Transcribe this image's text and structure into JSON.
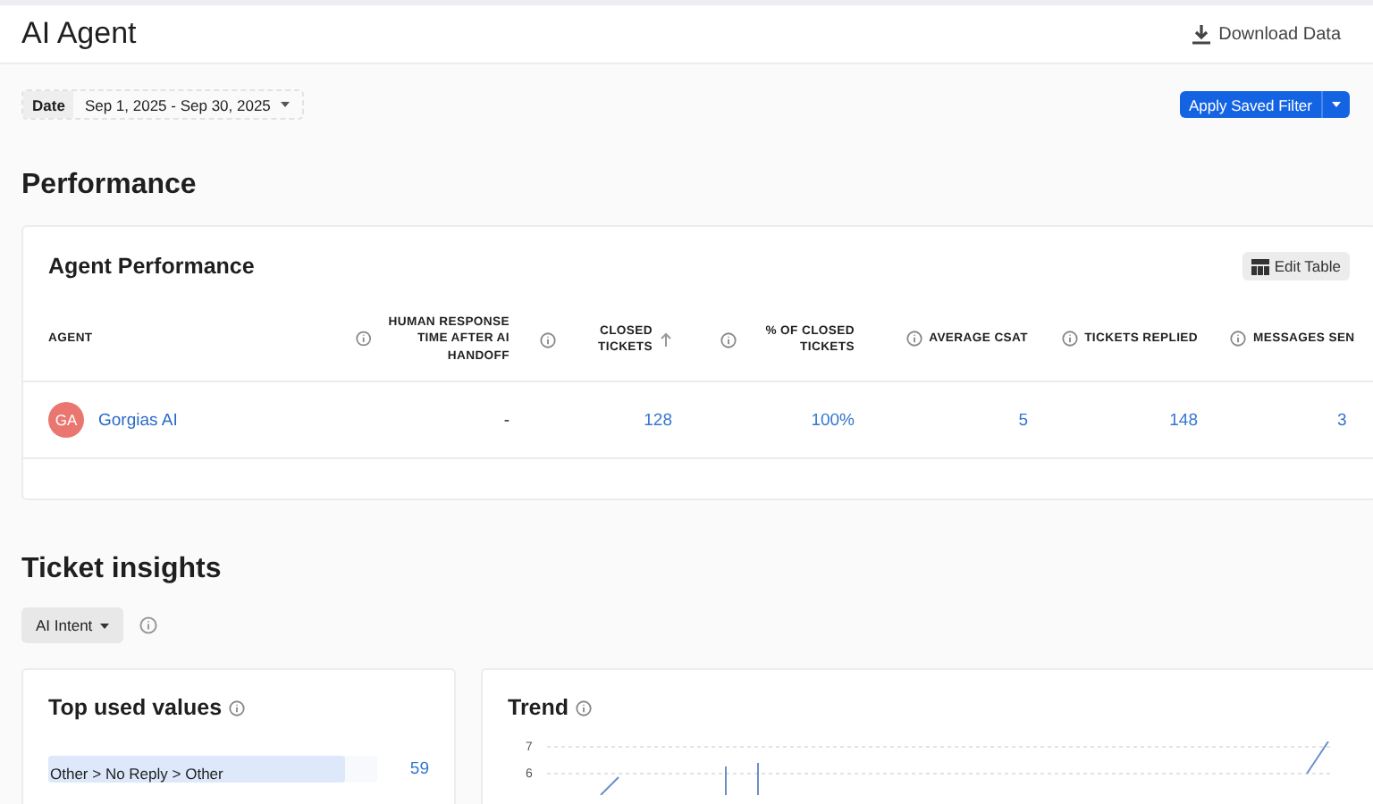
{
  "header": {
    "title": "AI Agent",
    "download_label": "Download Data"
  },
  "filters": {
    "date_label": "Date",
    "date_value": "Sep 1, 2025 - Sep 30, 2025",
    "saved_filter_label": "Apply Saved Filter"
  },
  "performance": {
    "title": "Performance",
    "card_title": "Agent Performance",
    "edit_label": "Edit Table",
    "columns": [
      {
        "label": "AGENT",
        "info": false,
        "sorted": false
      },
      {
        "label": "HUMAN RESPONSE TIME AFTER AI HANDOFF",
        "info": true,
        "sorted": false
      },
      {
        "label": "CLOSED TICKETS",
        "info": true,
        "sorted": true
      },
      {
        "label": "% OF CLOSED TICKETS",
        "info": true,
        "sorted": false
      },
      {
        "label": "AVERAGE CSAT",
        "info": true,
        "sorted": false
      },
      {
        "label": "TICKETS REPLIED",
        "info": true,
        "sorted": false
      },
      {
        "label": "MESSAGES SEN",
        "info": true,
        "sorted": false
      }
    ],
    "rows": [
      {
        "initials": "GA",
        "color": "#e9776f",
        "cells": [
          "Gorgias AI",
          "-",
          "128",
          "100%",
          "5",
          "148",
          "3"
        ]
      }
    ]
  },
  "insights": {
    "title": "Ticket insights",
    "dropdown_label": "AI Intent",
    "top_values": {
      "title": "Top used values",
      "items": [
        {
          "label": "Other > No Reply > Other",
          "count": "59",
          "level": 0.9
        }
      ]
    },
    "trend": {
      "title": "Trend",
      "y_tick_labels": [
        "7",
        "6"
      ]
    }
  }
}
